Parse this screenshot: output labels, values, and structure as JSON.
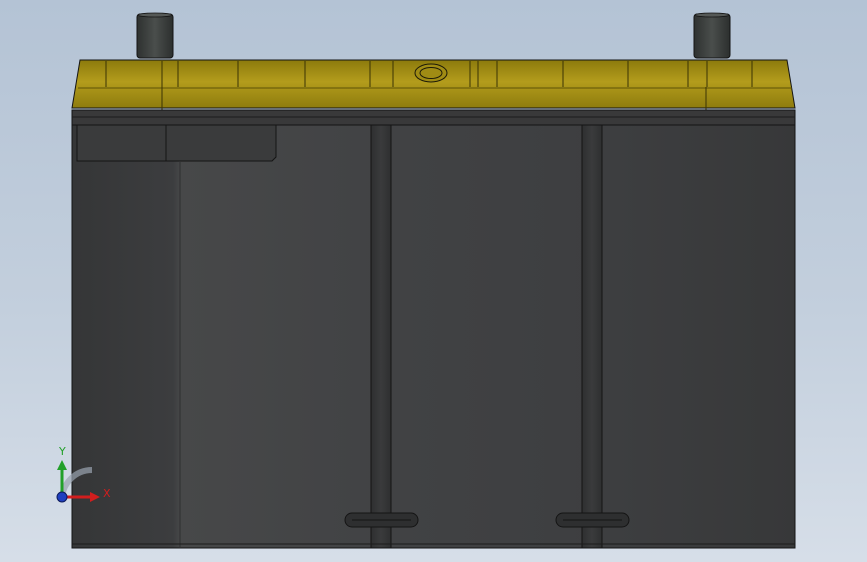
{
  "viewport": {
    "background_top": "#b4c3d5",
    "background_bottom": "#d6dee8"
  },
  "model": {
    "case_color": "#3c3d3f",
    "case_highlight": "#4b4c4e",
    "lid_color": "#b09a1a",
    "lid_dark": "#7a6a08",
    "terminal_color": "#3a3d3c",
    "edge_color": "#141414"
  },
  "triad": {
    "y_label": "Y",
    "x_label": "X",
    "y_color": "#22a02a",
    "x_color": "#d21e1e",
    "z_color": "#1f3fbf"
  }
}
